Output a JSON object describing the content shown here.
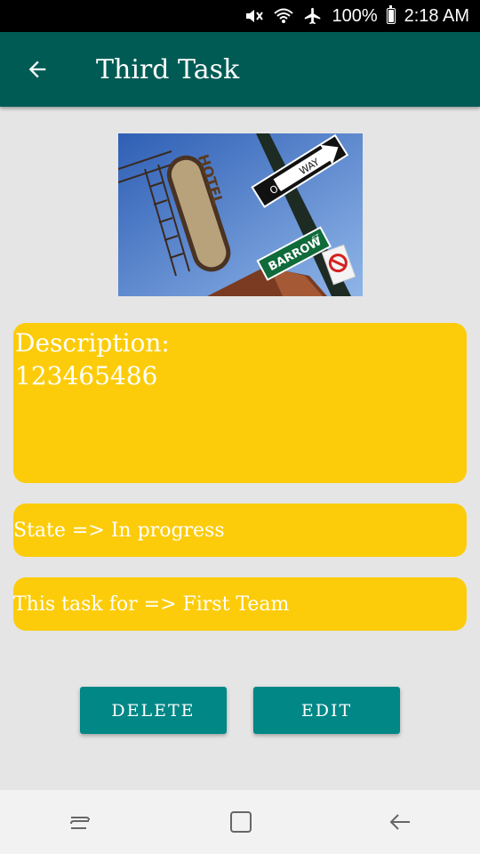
{
  "status_bar": {
    "battery": "100%",
    "time": "2:18 AM",
    "icons": [
      "mute-icon",
      "wifi-icon",
      "airplane-icon",
      "battery-icon"
    ]
  },
  "app_bar": {
    "title": "Third Task",
    "back_icon": "arrow-back-icon"
  },
  "photo": {
    "signs": {
      "hotel": "HOTEL",
      "one_way_1": "ONE",
      "one_way_2": "WAY",
      "street": "BARROW",
      "street_suffix": "ST"
    }
  },
  "details": {
    "description_label": "Description:",
    "description_value": "123465486",
    "state": "State => In progress",
    "team": "This task for => First Team"
  },
  "actions": {
    "delete": "DELETE",
    "edit": "EDIT"
  },
  "colors": {
    "app_bar": "#005b55",
    "card": "#fccc0a",
    "button": "#008786",
    "background": "#e5e5e5"
  },
  "nav_bar": {
    "icons": [
      "recent-apps-icon",
      "home-icon",
      "back-icon"
    ]
  }
}
